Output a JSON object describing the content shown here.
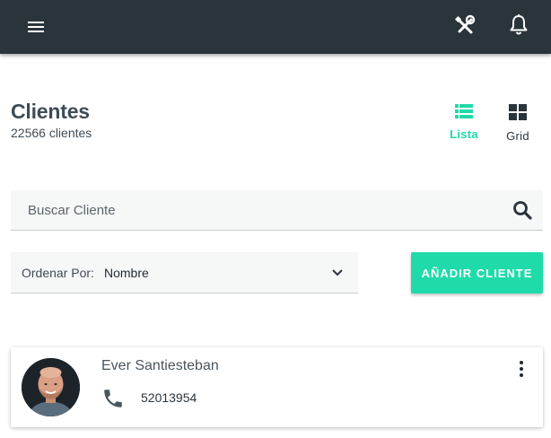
{
  "header": {
    "icons": [
      "menu-icon",
      "tools-icon",
      "bell-icon"
    ],
    "background": "#2a343b"
  },
  "page": {
    "title": "Clientes",
    "count_label": "22566 clientes"
  },
  "view_toggle": {
    "list_label": "Lista",
    "grid_label": "Grid",
    "active": "Lista",
    "accent": "#1fd9a8"
  },
  "search": {
    "placeholder": "Buscar Cliente",
    "value": ""
  },
  "sort": {
    "label": "Ordenar Por:",
    "value": "Nombre"
  },
  "actions": {
    "add_client_label": "AÑADIR CLIENTE",
    "add_client_color": "#1fdbaa"
  },
  "clients": [
    {
      "name": "Ever Santiesteban",
      "phone": "52013954"
    }
  ]
}
